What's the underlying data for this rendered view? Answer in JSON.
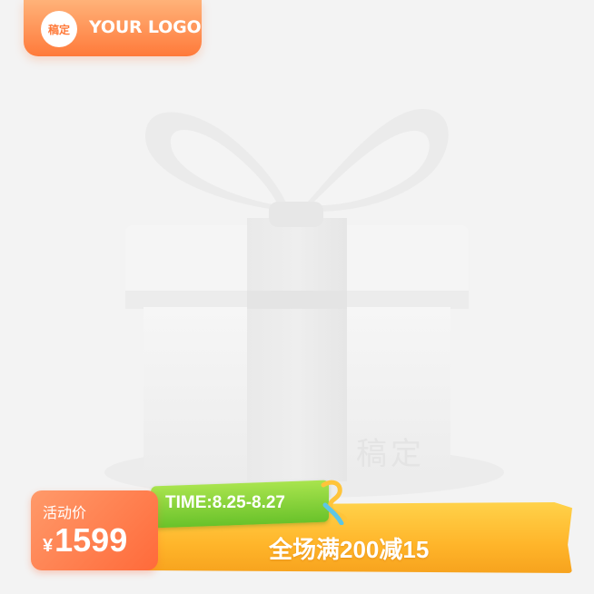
{
  "logo": {
    "badge_text": "稿定",
    "text": "YOUR LOGO"
  },
  "watermark": "稿定",
  "price": {
    "label": "活动价",
    "currency": "¥",
    "value": "1599"
  },
  "time_tag": "TIME:8.25-8.27",
  "promo": "全场满200减15",
  "icons": [
    "gift-box-illustration-icon",
    "ribbon-curl-icon"
  ],
  "colors": {
    "accent_orange": "#ff7a3a",
    "banner_yellow": "#ffc23a",
    "tag_green": "#7ccf36"
  }
}
